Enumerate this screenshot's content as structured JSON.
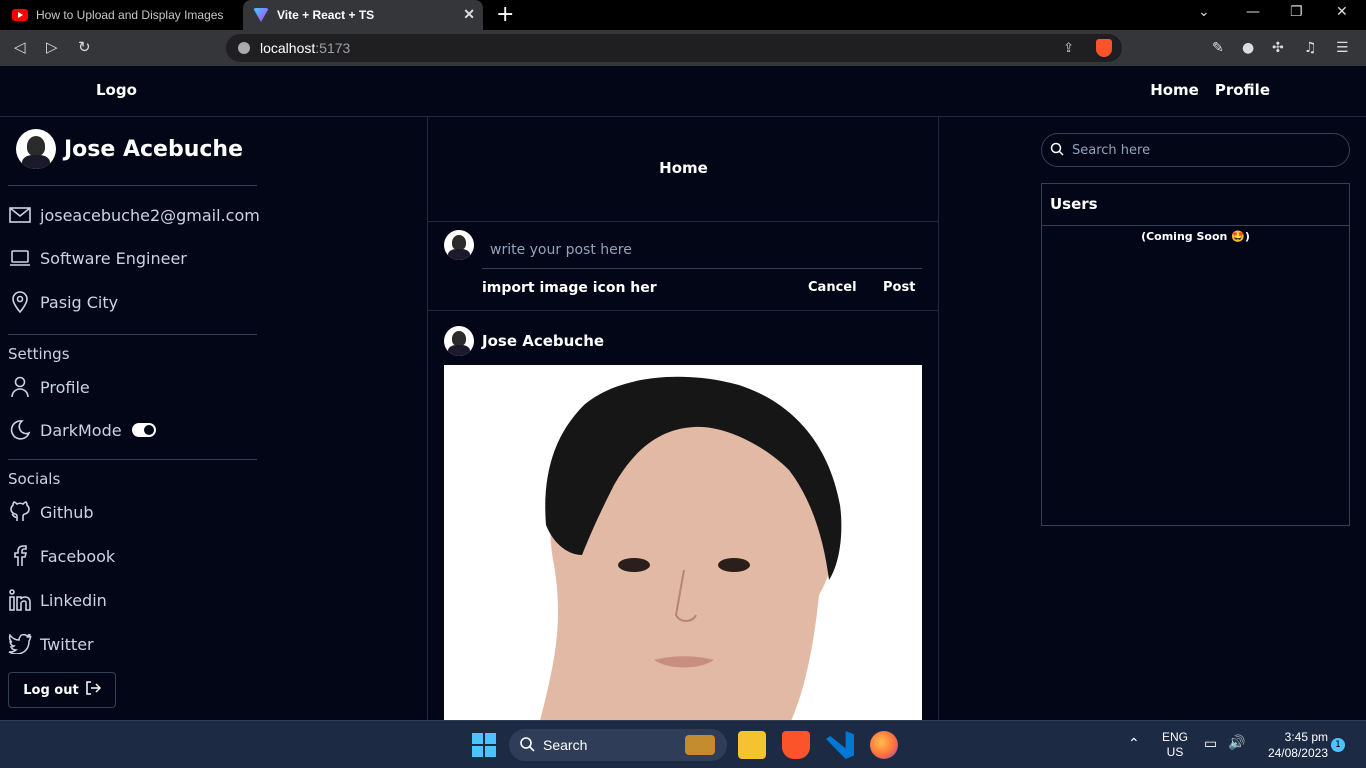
{
  "browser": {
    "tabs": [
      {
        "title": "How to Upload and Display Images us"
      },
      {
        "title": "Vite + React + TS"
      }
    ],
    "url_host": "localhost",
    "url_port": ":5173"
  },
  "header": {
    "logo": "Logo",
    "nav": [
      "Home",
      "Profile"
    ]
  },
  "sidebar": {
    "name": "Jose Acebuche",
    "email": "joseacebuche2@gmail.com",
    "job": "Software Engineer",
    "location": "Pasig City",
    "settings_title": "Settings",
    "profile": "Profile",
    "darkmode": "DarkMode",
    "socials_title": "Socials",
    "socials": [
      "Github",
      "Facebook",
      "Linkedin",
      "Twitter"
    ],
    "logout": "Log out"
  },
  "main": {
    "title": "Home",
    "composer_placeholder": "write your post here",
    "import_text": "import image icon her",
    "cancel": "Cancel",
    "post": "Post",
    "post_author": "Jose Acebuche"
  },
  "right": {
    "search_placeholder": "Search here",
    "users_title": "Users",
    "coming_soon": "(Coming Soon 🤩)"
  },
  "taskbar": {
    "search": "Search",
    "lang1": "ENG",
    "lang2": "US",
    "time": "3:45 pm",
    "date": "24/08/2023",
    "notif_count": "1"
  }
}
